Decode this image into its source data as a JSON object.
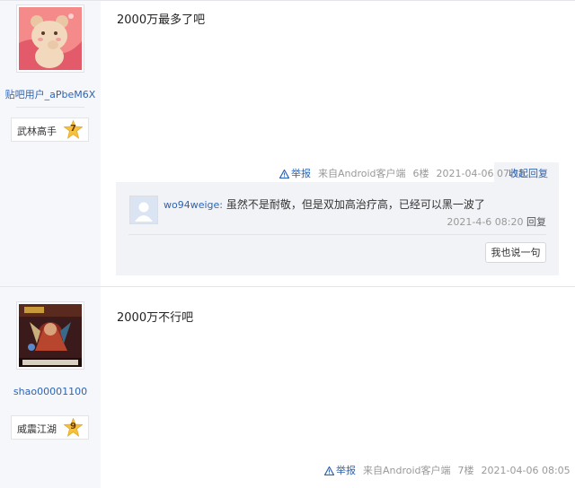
{
  "posts": [
    {
      "username": "贴吧用户_aPbeM6X",
      "level_title": "武林高手",
      "level": "7",
      "content": "2000万最多了吧",
      "tail": {
        "report": "举报",
        "source": "来自Android客户端",
        "floor": "6楼",
        "time": "2021-04-06 07:58",
        "action": "收起回复"
      },
      "replies": [
        {
          "user": "wo94weige",
          "colon": ":",
          "text": "虽然不是耐敬，但是双加高治疗高，已经可以黑一波了",
          "time": "2021-4-6 08:20",
          "reply": "回复"
        }
      ],
      "say_button": "我也说一句"
    },
    {
      "username": "shao00001100",
      "level_title": "威震江湖",
      "level": "9",
      "content": "2000万不行吧",
      "tail": {
        "report": "举报",
        "source": "来自Android客户端",
        "floor": "7楼",
        "time": "2021-04-06 08:05",
        "action": "回复"
      }
    }
  ],
  "colors": {
    "link": "#2d64b3",
    "meta": "#999999",
    "sidebar_bg": "#f6f7fb",
    "reply_bg": "#f2f3f7",
    "badge_star": "#f7c23b"
  },
  "icons": {
    "report": "warning-triangle-icon",
    "level": "star-badge-icon"
  }
}
